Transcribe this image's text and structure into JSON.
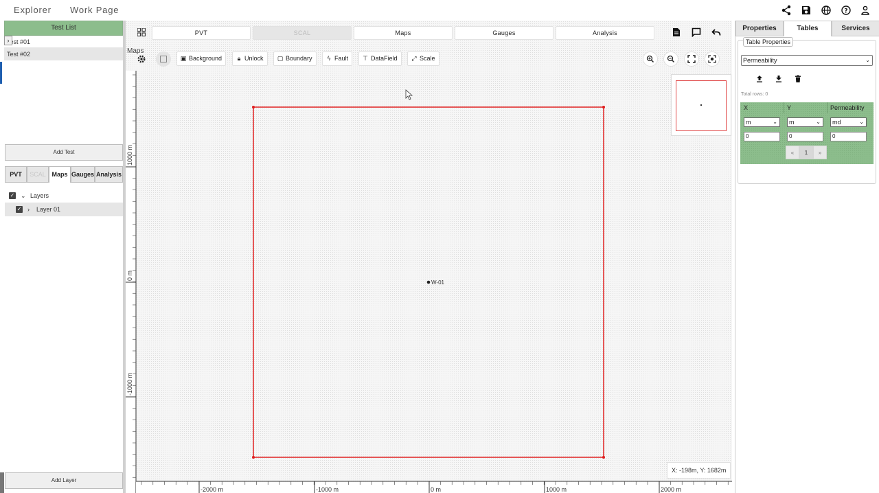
{
  "topbar": {
    "tabs": [
      "Explorer",
      "Work Page"
    ],
    "icons": [
      "share-icon",
      "save-icon",
      "globe-icon",
      "help-icon",
      "account-icon"
    ]
  },
  "left": {
    "test_list_title": "Test List",
    "tests": [
      "Test #01",
      "Test #02"
    ],
    "add_test_label": "Add Test",
    "tabs": [
      "PVT",
      "SCAL",
      "Maps",
      "Gauges",
      "Analysis"
    ],
    "active_tab": "Maps",
    "tree": {
      "root_label": "Layers",
      "child_label": "Layer 01"
    },
    "add_layer_label": "Add Layer"
  },
  "center": {
    "module_tabs": [
      "PVT",
      "SCAL",
      "Maps",
      "Gauges",
      "Analysis"
    ],
    "maps_label": "Maps",
    "toolbar": {
      "background": "Background",
      "unlock": "Unlock",
      "boundary": "Boundary",
      "fault": "Fault",
      "datafield": "DataField",
      "scale": "Scale"
    },
    "x_ticks": [
      "-2000 m",
      "-1000 m",
      "0 m",
      "1000 m",
      "2000 m"
    ],
    "y_ticks": [
      "1000 m",
      "0 m",
      "-1000 m"
    ],
    "well_label": "W-01",
    "coord_readout": "X: -198m, Y: 1682m",
    "boundary_color": "#e02020"
  },
  "right": {
    "tabs": [
      "Properties",
      "Tables",
      "Services"
    ],
    "active_tab": "Tables",
    "legend": "Table Properties",
    "selected_table": "Permeability",
    "total_rows": "Total rows: 0",
    "columns": [
      "X",
      "Y",
      "Permeability"
    ],
    "units": [
      "m",
      "m",
      "md"
    ],
    "values": [
      "0",
      "0",
      "0"
    ],
    "pager": [
      "«",
      "1",
      "»"
    ]
  }
}
